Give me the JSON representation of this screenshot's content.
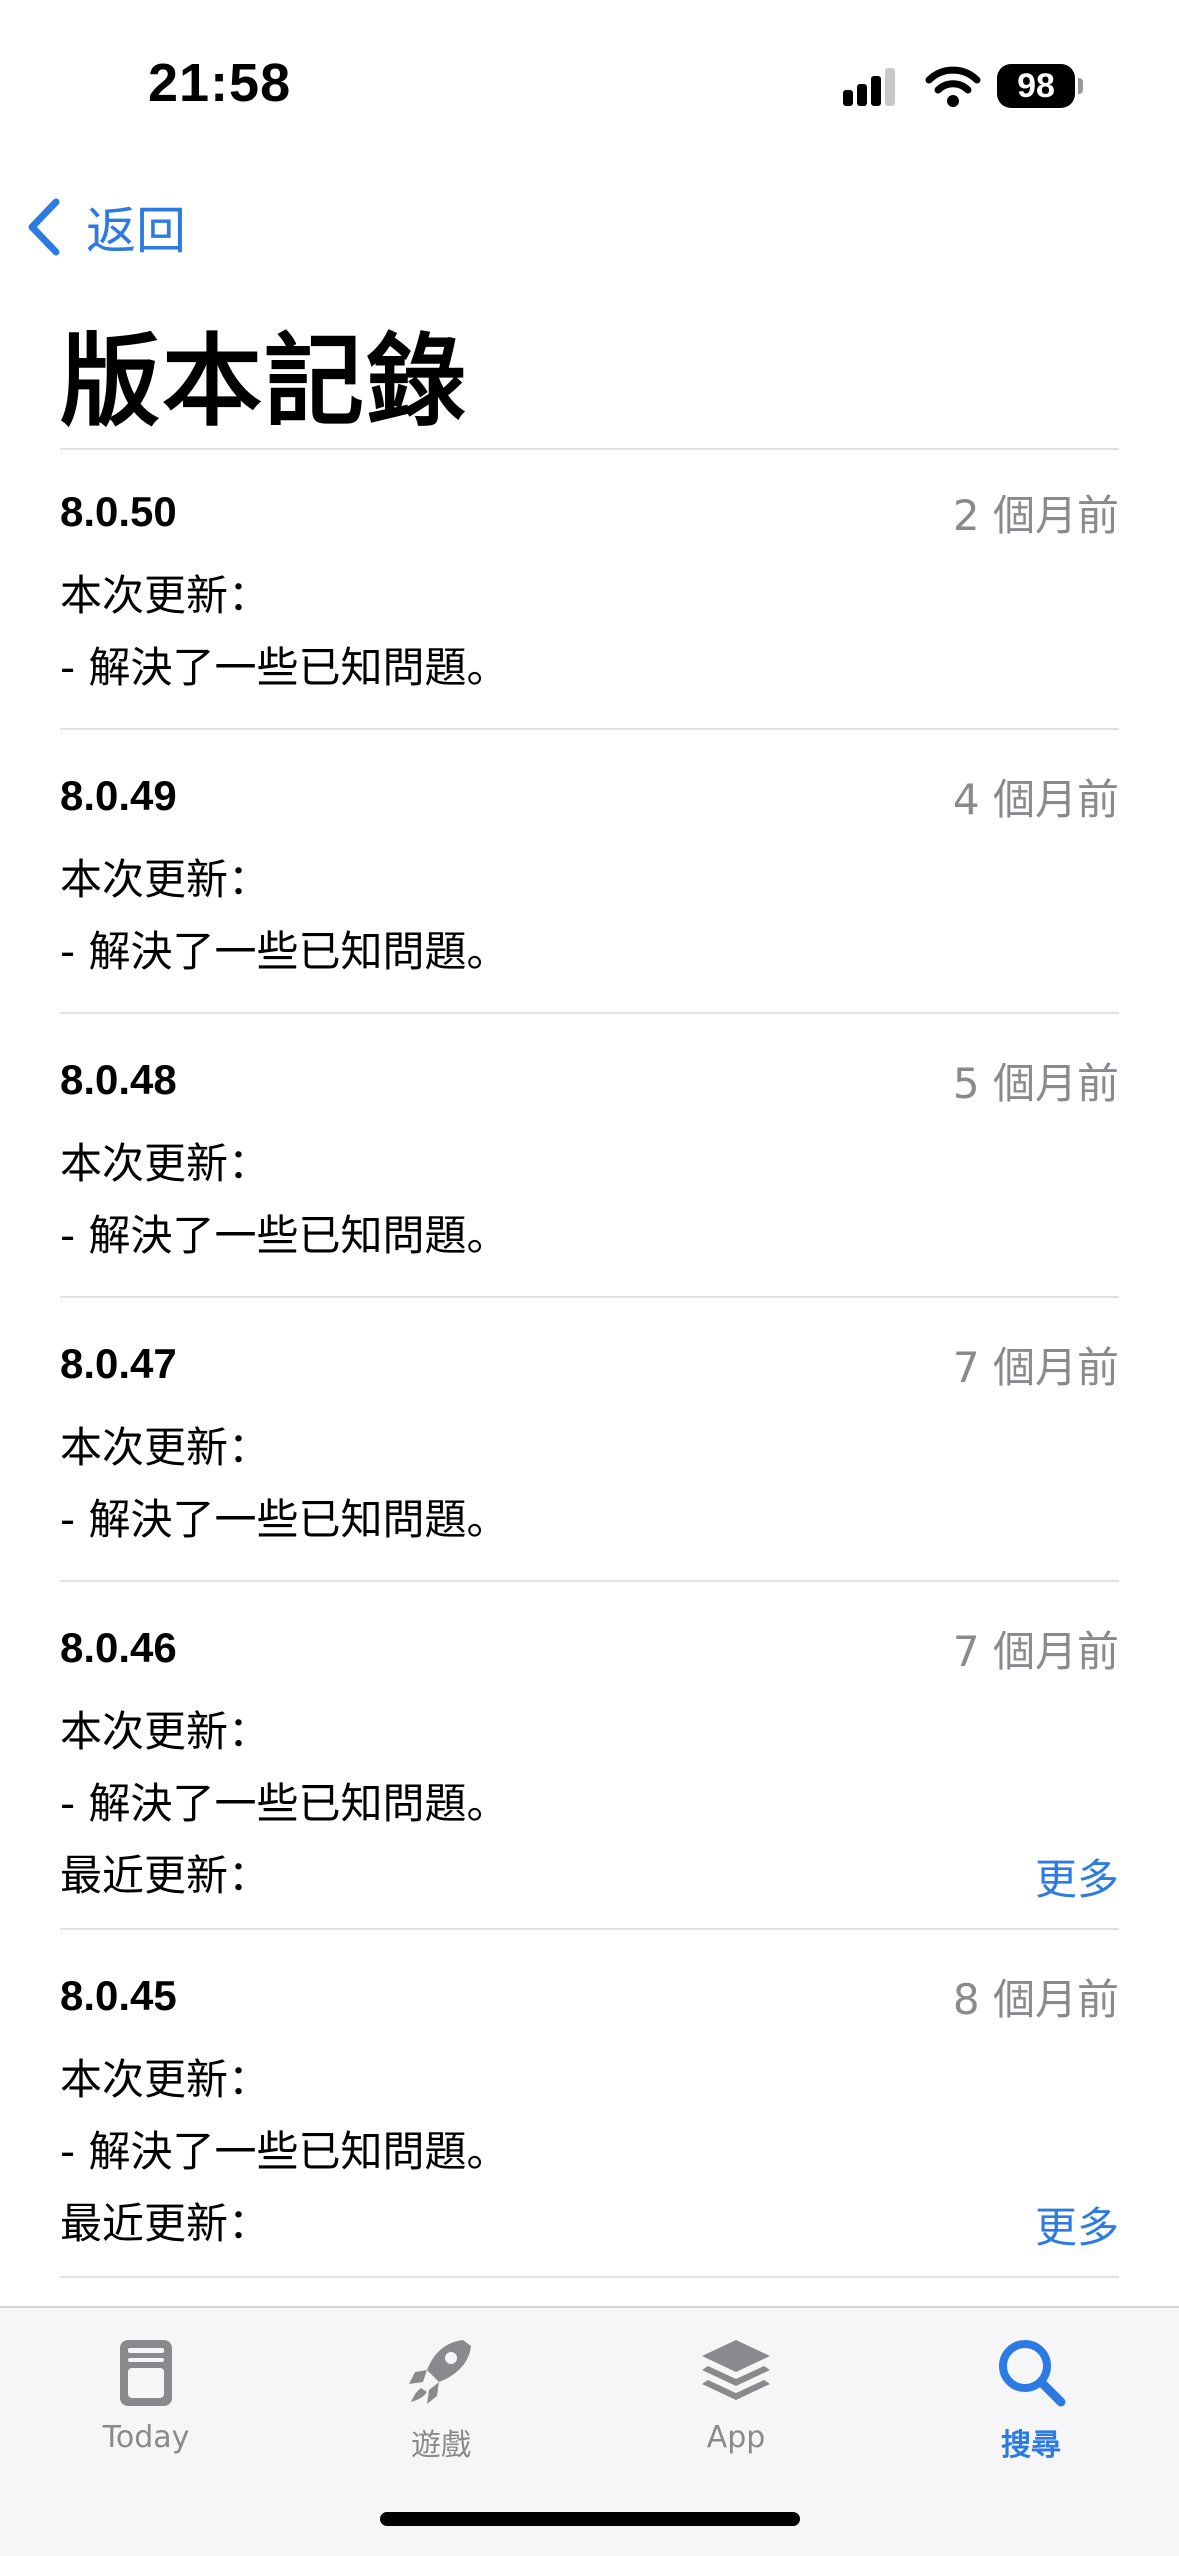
{
  "status_bar": {
    "time": "21:58",
    "battery": "98"
  },
  "nav": {
    "back_label": "返回"
  },
  "page": {
    "title": "版本記錄"
  },
  "versions": [
    {
      "version": "8.0.50",
      "date": "2 個月前",
      "notes": [
        "本次更新：",
        "- 解決了一些已知問題。"
      ],
      "recent": ""
    },
    {
      "version": "8.0.49",
      "date": "4 個月前",
      "notes": [
        "本次更新：",
        "- 解決了一些已知問題。"
      ],
      "recent": ""
    },
    {
      "version": "8.0.48",
      "date": "5 個月前",
      "notes": [
        "本次更新：",
        "- 解決了一些已知問題。"
      ],
      "recent": ""
    },
    {
      "version": "8.0.47",
      "date": "7 個月前",
      "notes": [
        "本次更新：",
        "- 解決了一些已知問題。"
      ],
      "recent": ""
    },
    {
      "version": "8.0.46",
      "date": "7 個月前",
      "notes": [
        "本次更新：",
        "- 解決了一些已知問題。"
      ],
      "recent": "最近更新：",
      "more": "更多"
    },
    {
      "version": "8.0.45",
      "date": "8 個月前",
      "notes": [
        "本次更新：",
        "- 解決了一些已知問題。"
      ],
      "recent": "最近更新：",
      "more": "更多"
    }
  ],
  "tabs": [
    {
      "label": "Today",
      "icon": "today-icon",
      "active": false
    },
    {
      "label": "遊戲",
      "icon": "rocket-icon",
      "active": false
    },
    {
      "label": "App",
      "icon": "app-stack-icon",
      "active": false
    },
    {
      "label": "搜尋",
      "icon": "search-icon",
      "active": true
    }
  ],
  "colors": {
    "accent": "#2c7be5",
    "secondary_text": "#8a8a8e",
    "divider": "#e2e2e4"
  }
}
